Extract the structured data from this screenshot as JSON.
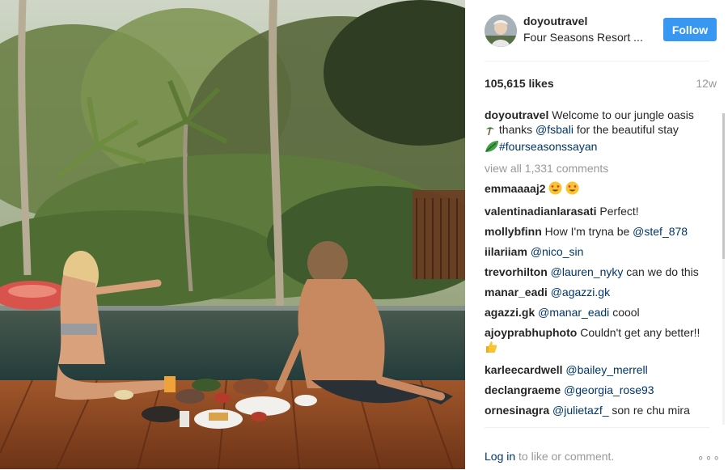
{
  "post": {
    "username": "doyoutravel",
    "location": "Four Seasons Resort ...",
    "follow_label": "Follow",
    "likes": "105,615 likes",
    "age": "12w",
    "caption": {
      "user": "doyoutravel",
      "text_1": "Welcome to our jungle oasis",
      "text_2": "thanks",
      "mention": "@fsbali",
      "text_3": "for the beautiful stay",
      "hashtag": "#fourseasonssayan"
    },
    "view_all": "view all 1,331 comments",
    "comments": [
      {
        "user": "emmaaaaj2",
        "text": ""
      },
      {
        "user": "valentinadianlarasati",
        "text": "Perfect!"
      },
      {
        "user": "mollybfinn",
        "text": "How I'm tryna be",
        "mention": "@stef_878"
      },
      {
        "user": "iilariiam",
        "mention": "@nico_sin"
      },
      {
        "user": "trevorhilton",
        "mention": "@lauren_nyky",
        "text": "can we do this"
      },
      {
        "user": "manar_eadi",
        "mention": "@agazzi.gk"
      },
      {
        "user": "agazzi.gk",
        "mention": "@manar_eadi",
        "text": "coool"
      },
      {
        "user": "ajoyprabhuphoto",
        "text": "Couldn't get any better!!"
      },
      {
        "user": "karleecardwell",
        "mention": "@bailey_merrell"
      },
      {
        "user": "declangraeme",
        "mention": "@georgia_rose93"
      },
      {
        "user": "ornesinagra",
        "mention": "@julietazf_",
        "text": "son re chu mira"
      }
    ],
    "footer": {
      "login": "Log in",
      "rest": "to like or comment.",
      "more": "∘∘∘"
    }
  },
  "colors": {
    "accent": "#3897f0",
    "link": "#003569",
    "muted": "#999999"
  },
  "icons": [
    "heart-eyes-emoji",
    "leaf-emoji",
    "thumbs-up-emoji",
    "more-options-icon"
  ]
}
